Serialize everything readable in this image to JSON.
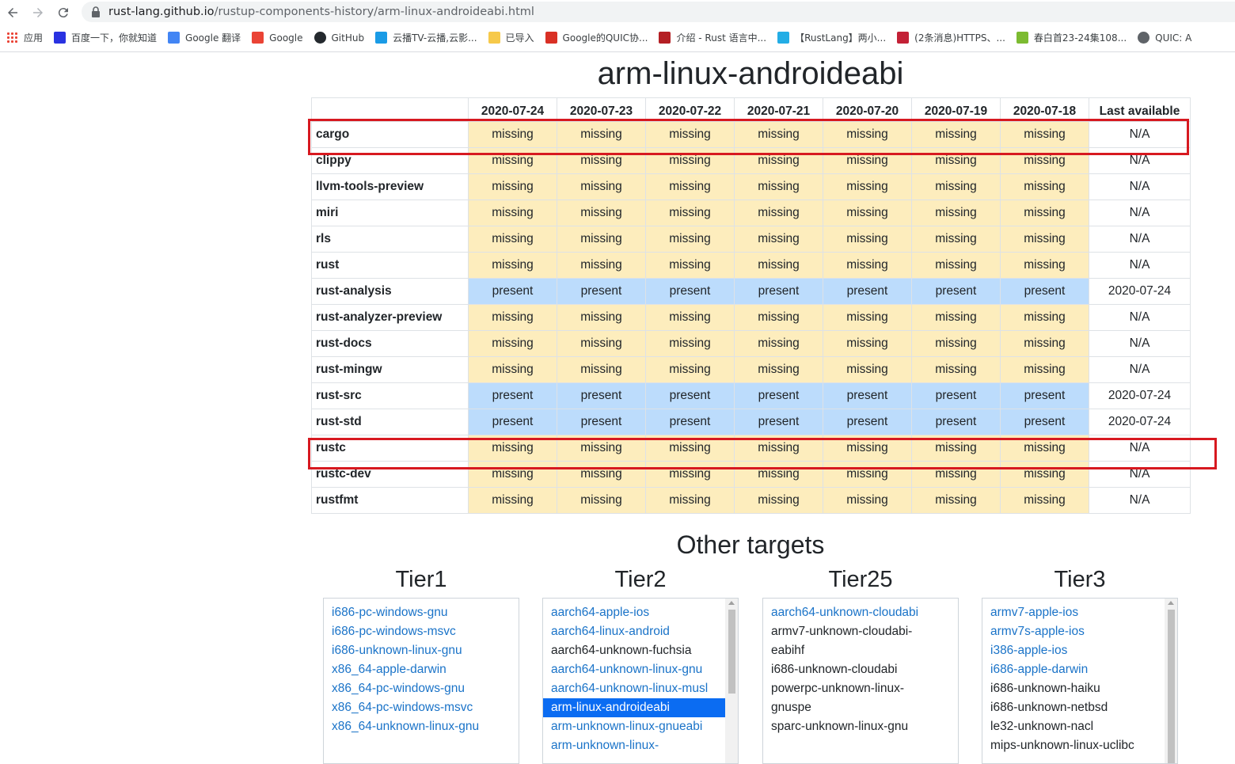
{
  "browser": {
    "url_host": "rust-lang.github.io",
    "url_path": "/rustup-components-history/arm-linux-androideabi.html",
    "bookmarks": [
      {
        "label": "应用",
        "icon": "apps-grid-icon",
        "color": "#4285f4"
      },
      {
        "label": "百度一下，你就知道",
        "icon": "baidu-paw-icon",
        "color": "#2932e1"
      },
      {
        "label": "Google 翻译",
        "icon": "google-translate-icon",
        "color": "#4285f4"
      },
      {
        "label": "Google",
        "icon": "google-g-icon",
        "color": "#ea4335"
      },
      {
        "label": "GitHub",
        "icon": "github-icon",
        "color": "#24292e"
      },
      {
        "label": "云播TV-云播,云影...",
        "icon": "cloud-icon",
        "color": "#1a9be6"
      },
      {
        "label": "已导入",
        "icon": "folder-icon",
        "color": "#f6c94a"
      },
      {
        "label": "Google的QUIC协...",
        "icon": "bookmark-icon",
        "color": "#d93025"
      },
      {
        "label": "介绍 - Rust 语言中...",
        "icon": "rust-book-icon",
        "color": "#b41f24"
      },
      {
        "label": "【RustLang】两小...",
        "icon": "bilibili-icon",
        "color": "#23ade5"
      },
      {
        "label": "(2条消息)HTTPS、...",
        "icon": "csdn-icon",
        "color": "#c32136"
      },
      {
        "label": "春白首23-24集108...",
        "icon": "leaf-icon",
        "color": "#7cbb31"
      },
      {
        "label": "QUIC: A",
        "icon": "globe-icon",
        "color": "#5f6368"
      }
    ]
  },
  "page": {
    "title": "arm-linux-androideabi",
    "columns": [
      "2020-07-24",
      "2020-07-23",
      "2020-07-22",
      "2020-07-21",
      "2020-07-20",
      "2020-07-19",
      "2020-07-18",
      "Last available"
    ],
    "rows": [
      {
        "name": "cargo",
        "status": "missing",
        "last": "N/A"
      },
      {
        "name": "clippy",
        "status": "missing",
        "last": "N/A"
      },
      {
        "name": "llvm-tools-preview",
        "status": "missing",
        "last": "N/A"
      },
      {
        "name": "miri",
        "status": "missing",
        "last": "N/A"
      },
      {
        "name": "rls",
        "status": "missing",
        "last": "N/A"
      },
      {
        "name": "rust",
        "status": "missing",
        "last": "N/A"
      },
      {
        "name": "rust-analysis",
        "status": "present",
        "last": "2020-07-24"
      },
      {
        "name": "rust-analyzer-preview",
        "status": "missing",
        "last": "N/A"
      },
      {
        "name": "rust-docs",
        "status": "missing",
        "last": "N/A"
      },
      {
        "name": "rust-mingw",
        "status": "missing",
        "last": "N/A"
      },
      {
        "name": "rust-src",
        "status": "present",
        "last": "2020-07-24"
      },
      {
        "name": "rust-std",
        "status": "present",
        "last": "2020-07-24"
      },
      {
        "name": "rustc",
        "status": "missing",
        "last": "N/A"
      },
      {
        "name": "rustc-dev",
        "status": "missing",
        "last": "N/A"
      },
      {
        "name": "rustfmt",
        "status": "missing",
        "last": "N/A"
      }
    ],
    "highlighted_rows": [
      "cargo",
      "rustc"
    ],
    "colors": {
      "missing": "#fdedbd",
      "present": "#bcdcfc",
      "highlight": "#d71920",
      "link": "#1a73c8"
    },
    "other_targets_title": "Other targets",
    "tiers": [
      {
        "title": "Tier1",
        "scrollable": false,
        "items": [
          {
            "label": "i686-pc-windows-gnu",
            "link": true
          },
          {
            "label": "i686-pc-windows-msvc",
            "link": true
          },
          {
            "label": "i686-unknown-linux-gnu",
            "link": true
          },
          {
            "label": "x86_64-apple-darwin",
            "link": true
          },
          {
            "label": "x86_64-pc-windows-gnu",
            "link": true
          },
          {
            "label": "x86_64-pc-windows-msvc",
            "link": true
          },
          {
            "label": "x86_64-unknown-linux-gnu",
            "link": true
          }
        ]
      },
      {
        "title": "Tier2",
        "scrollable": true,
        "items": [
          {
            "label": "aarch64-apple-ios",
            "link": true
          },
          {
            "label": "aarch64-linux-android",
            "link": true
          },
          {
            "label": "aarch64-unknown-fuchsia",
            "link": false
          },
          {
            "label": "aarch64-unknown-linux-gnu",
            "link": true
          },
          {
            "label": "aarch64-unknown-linux-musl",
            "link": true
          },
          {
            "label": "arm-linux-androideabi",
            "link": true,
            "selected": true
          },
          {
            "label": "arm-unknown-linux-gnueabi",
            "link": true
          },
          {
            "label": "arm-unknown-linux-",
            "link": true
          }
        ]
      },
      {
        "title": "Tier25",
        "scrollable": false,
        "items": [
          {
            "label": "aarch64-unknown-cloudabi",
            "link": true
          },
          {
            "label": "armv7-unknown-cloudabi-eabihf",
            "link": false
          },
          {
            "label": "i686-unknown-cloudabi",
            "link": false
          },
          {
            "label": "powerpc-unknown-linux-gnuspe",
            "link": false
          },
          {
            "label": "sparc-unknown-linux-gnu",
            "link": false
          }
        ]
      },
      {
        "title": "Tier3",
        "scrollable": true,
        "items": [
          {
            "label": "armv7-apple-ios",
            "link": true
          },
          {
            "label": "armv7s-apple-ios",
            "link": true
          },
          {
            "label": "i386-apple-ios",
            "link": true
          },
          {
            "label": "i686-apple-darwin",
            "link": true
          },
          {
            "label": "i686-unknown-haiku",
            "link": false
          },
          {
            "label": "i686-unknown-netbsd",
            "link": false
          },
          {
            "label": "le32-unknown-nacl",
            "link": false
          },
          {
            "label": "mips-unknown-linux-uclibc",
            "link": false
          }
        ]
      }
    ]
  }
}
